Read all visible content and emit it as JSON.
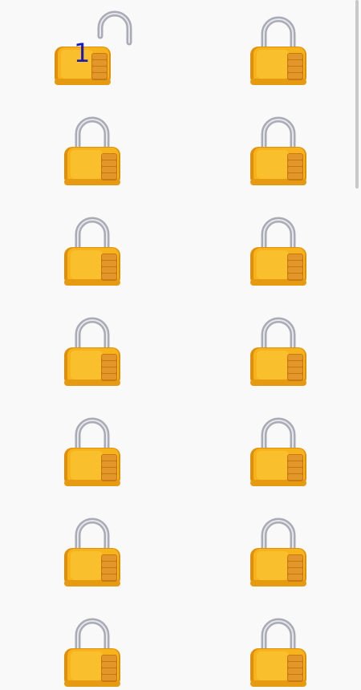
{
  "locks": [
    {
      "id": 1,
      "state": "unlocked",
      "label": "1"
    },
    {
      "id": 2,
      "state": "locked",
      "label": ""
    },
    {
      "id": 3,
      "state": "locked",
      "label": ""
    },
    {
      "id": 4,
      "state": "locked",
      "label": ""
    },
    {
      "id": 5,
      "state": "locked",
      "label": ""
    },
    {
      "id": 6,
      "state": "locked",
      "label": ""
    },
    {
      "id": 7,
      "state": "locked",
      "label": ""
    },
    {
      "id": 8,
      "state": "locked",
      "label": ""
    },
    {
      "id": 9,
      "state": "locked",
      "label": ""
    },
    {
      "id": 10,
      "state": "locked",
      "label": ""
    },
    {
      "id": 11,
      "state": "locked",
      "label": ""
    },
    {
      "id": 12,
      "state": "locked",
      "label": ""
    },
    {
      "id": 13,
      "state": "locked",
      "label": ""
    },
    {
      "id": 14,
      "state": "locked",
      "label": ""
    }
  ],
  "colors": {
    "background": "#f9f9f9",
    "lock_body": "#f7b31b",
    "lock_body_dark": "#e08f0a",
    "shackle": "#a9abb5",
    "dial": "#d9871a",
    "number": "#1a1ab8"
  }
}
